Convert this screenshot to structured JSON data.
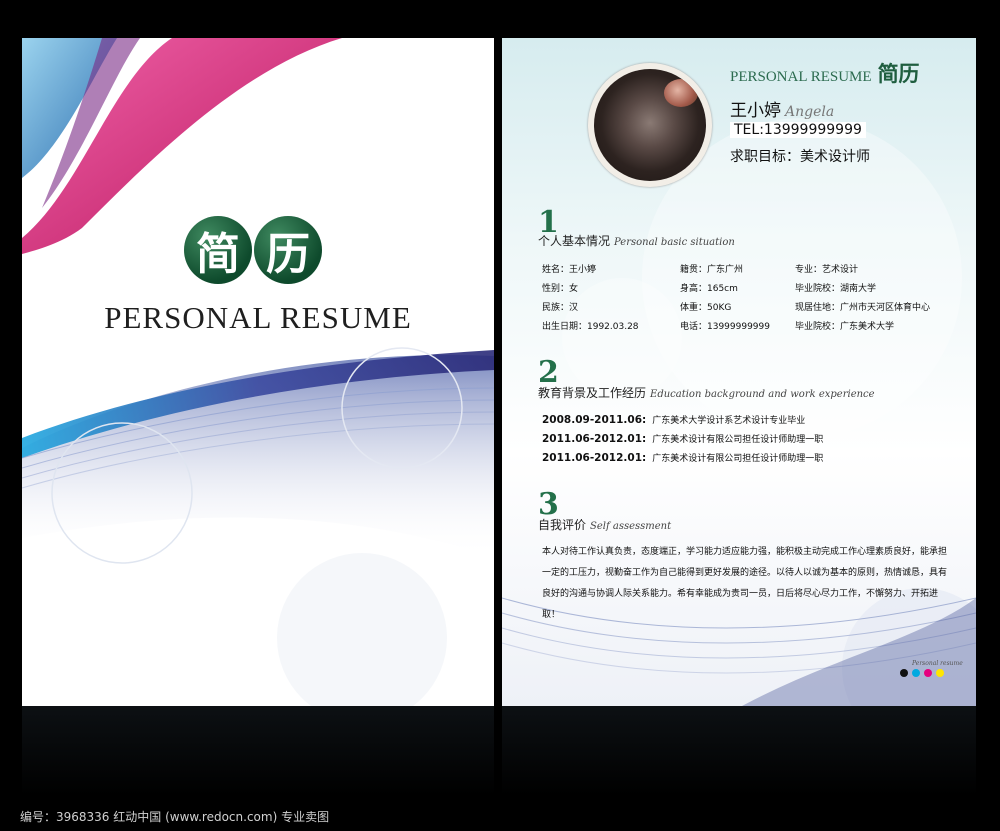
{
  "cover": {
    "logo_char_1": "简",
    "logo_char_2": "历",
    "title": "PERSONAL RESUME"
  },
  "resume": {
    "header_en": "PERSONAL RESUME",
    "header_cn": "简历",
    "name_cn": "王小婷",
    "name_en": "Angela",
    "tel": "TEL:13999999999",
    "goal": "求职目标：美术设计师",
    "sections": [
      {
        "num": "1",
        "title_cn": "个人基本情况",
        "title_en": "Personal basic situation"
      },
      {
        "num": "2",
        "title_cn": "教育背景及工作经历",
        "title_en": "Education background and work experience"
      },
      {
        "num": "3",
        "title_cn": "自我评价",
        "title_en": "Self assessment"
      }
    ],
    "info": [
      [
        "姓名：王小婷",
        "籍贯：广东广州",
        "专业：艺术设计"
      ],
      [
        "性别：女",
        "身高：165cm",
        "毕业院校：湖南大学"
      ],
      [
        "民族：汉",
        "体重：50KG",
        "现居住地：广州市天河区体育中心"
      ],
      [
        "出生日期：1992.03.28",
        "电话：13999999999",
        "毕业院校：广东美术大学"
      ]
    ],
    "education": [
      {
        "date": "2008.09-2011.06:",
        "desc": "广东美术大学设计系艺术设计专业毕业"
      },
      {
        "date": "2011.06-2012.01:",
        "desc": "广东美术设计有限公司担任设计师助理一职"
      },
      {
        "date": "2011.06-2012.01:",
        "desc": "广东美术设计有限公司担任设计师助理一职"
      }
    ],
    "self_assessment": "本人对待工作认真负责，态度端正，学习能力适应能力强，能积极主动完成工作心理素质良好，能承担一定的工压力，视勤奋工作为自己能得到更好发展的途径。以待人以诚为基本的原则，热情诚恳，具有良好的沟通与协调人际关系能力。希有幸能成为贵司一员，日后将尽心尽力工作，不懈努力、开拓进取！",
    "palette_label": "Personal resume",
    "palette": [
      "#111111",
      "#00a9e0",
      "#e5007f",
      "#ffe600"
    ]
  },
  "footer": "编号：3968336    红动中国 (www.redocn.com)    专业卖图"
}
